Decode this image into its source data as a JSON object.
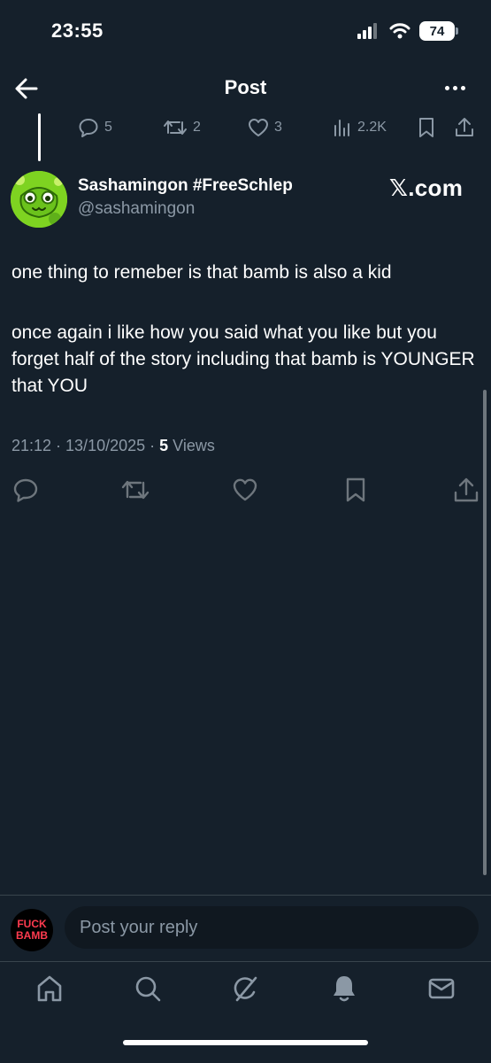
{
  "status_bar": {
    "time": "23:55",
    "battery": "74"
  },
  "header": {
    "title": "Post"
  },
  "parent_actions": {
    "replies": "5",
    "reposts": "2",
    "likes": "3",
    "views": "2.2K"
  },
  "author": {
    "display_name": "Sashamingon #FreeSchlep",
    "handle": "@sashamingon",
    "badge": "𝕏.com"
  },
  "post": {
    "paragraphs": [
      "one thing to remeber is that bamb is also a kid",
      "once again i like how you said what you like but you forget half of the story including that bamb is YOUNGER that YOU"
    ],
    "timestamp": "21:12 · 13/10/2025 · ",
    "view_count": "5",
    "views_label": " Views"
  },
  "reply": {
    "avatar_line1": "FUCK",
    "avatar_line2": "BAMB",
    "placeholder": "Post your reply"
  },
  "icons": {
    "back": "back-arrow-icon",
    "more": "more-horizontal-icon",
    "reply": "reply-icon",
    "repost": "repost-icon",
    "like": "heart-icon",
    "views": "views-icon",
    "bookmark": "bookmark-icon",
    "share": "share-icon",
    "nav": [
      "home-icon",
      "search-icon",
      "grok-icon",
      "notifications-icon",
      "messages-icon"
    ]
  },
  "colors": {
    "background": "#15202b",
    "secondary_text": "#8b98a5",
    "action_icon": "#6e767d",
    "avatar_green": "#7ed321",
    "reply_avatar_text": "#ff3b4f"
  }
}
